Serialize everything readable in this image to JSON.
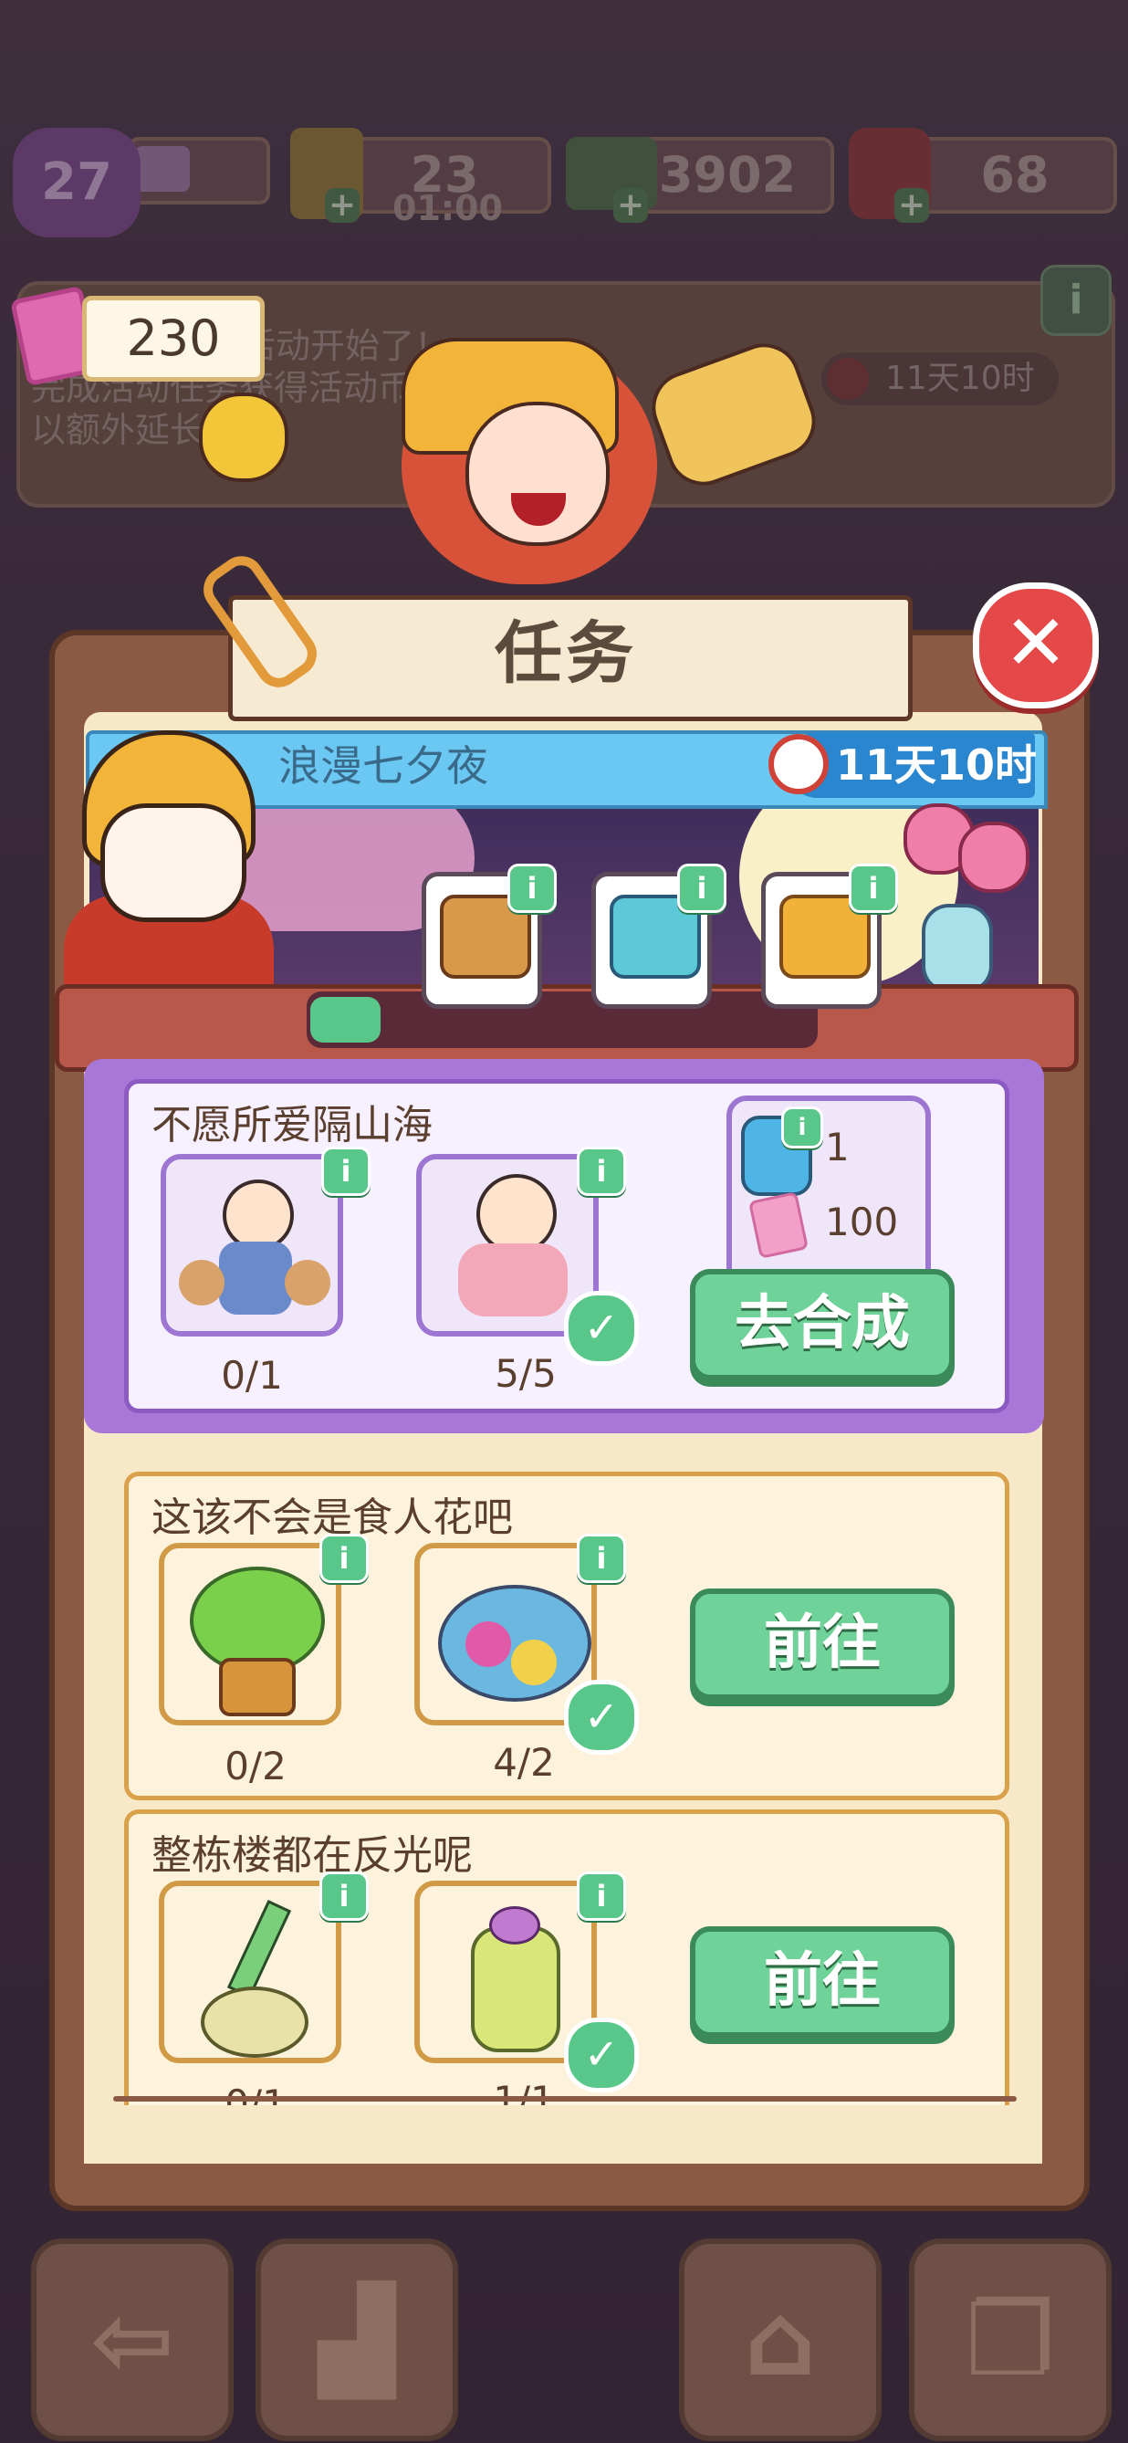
{
  "hud": {
    "level": "27",
    "energy": "23",
    "energy_timer": "01:00",
    "cash": "3902",
    "gems": "68",
    "plus": "+"
  },
  "event_banner": {
    "tickets": "230",
    "line1": "活动开始了！",
    "line2": "完成活动任务获得活动币",
    "line2b": "动不",
    "line3": "以额外延长",
    "timer": "11天10时",
    "info": "i"
  },
  "dialog": {
    "title": "任务",
    "close_glyph": "✕"
  },
  "event_strip": {
    "name": "浪漫七夕夜",
    "timer": "11天10时",
    "progress_fraction": 0.14,
    "chests": [
      {
        "name": "wooden-chest",
        "info": "i"
      },
      {
        "name": "blue-chest",
        "info": "i"
      },
      {
        "name": "gold-chest",
        "info": "i"
      }
    ]
  },
  "tasks": [
    {
      "title": "不愿所爱隔山海",
      "items": [
        {
          "icon": "cowherd-icon",
          "count": "0/1",
          "done": false,
          "info": "i"
        },
        {
          "icon": "weaver-girl-icon",
          "count": "5/5",
          "done": true,
          "info": "i"
        }
      ],
      "rewards": [
        {
          "icon": "energy-potion-icon",
          "amount": "1"
        },
        {
          "icon": "ticket-icon",
          "amount": "100"
        }
      ],
      "button": "去合成"
    },
    {
      "title": "这该不会是食人花吧",
      "items": [
        {
          "icon": "potted-tree-icon",
          "count": "0/2",
          "done": false,
          "info": "i"
        },
        {
          "icon": "flower-basket-icon",
          "count": "4/2",
          "done": true,
          "info": "i"
        }
      ],
      "button": "前往"
    },
    {
      "title": "整栋楼都在反光呢",
      "items": [
        {
          "icon": "mop-icon",
          "count": "0/1",
          "done": false,
          "info": "i"
        },
        {
          "icon": "detergent-bottle-icon",
          "count": "1/1",
          "done": true,
          "info": "i"
        }
      ],
      "button": "前往"
    }
  ],
  "check_glyph": "✓",
  "nav": [
    {
      "name": "back-button",
      "glyph": "⇦"
    },
    {
      "name": "leaderboard-button",
      "glyph": "▟"
    },
    {
      "name": "shop-basket-button",
      "glyph": "⌂"
    },
    {
      "name": "task-board-button",
      "glyph": "❐"
    }
  ]
}
